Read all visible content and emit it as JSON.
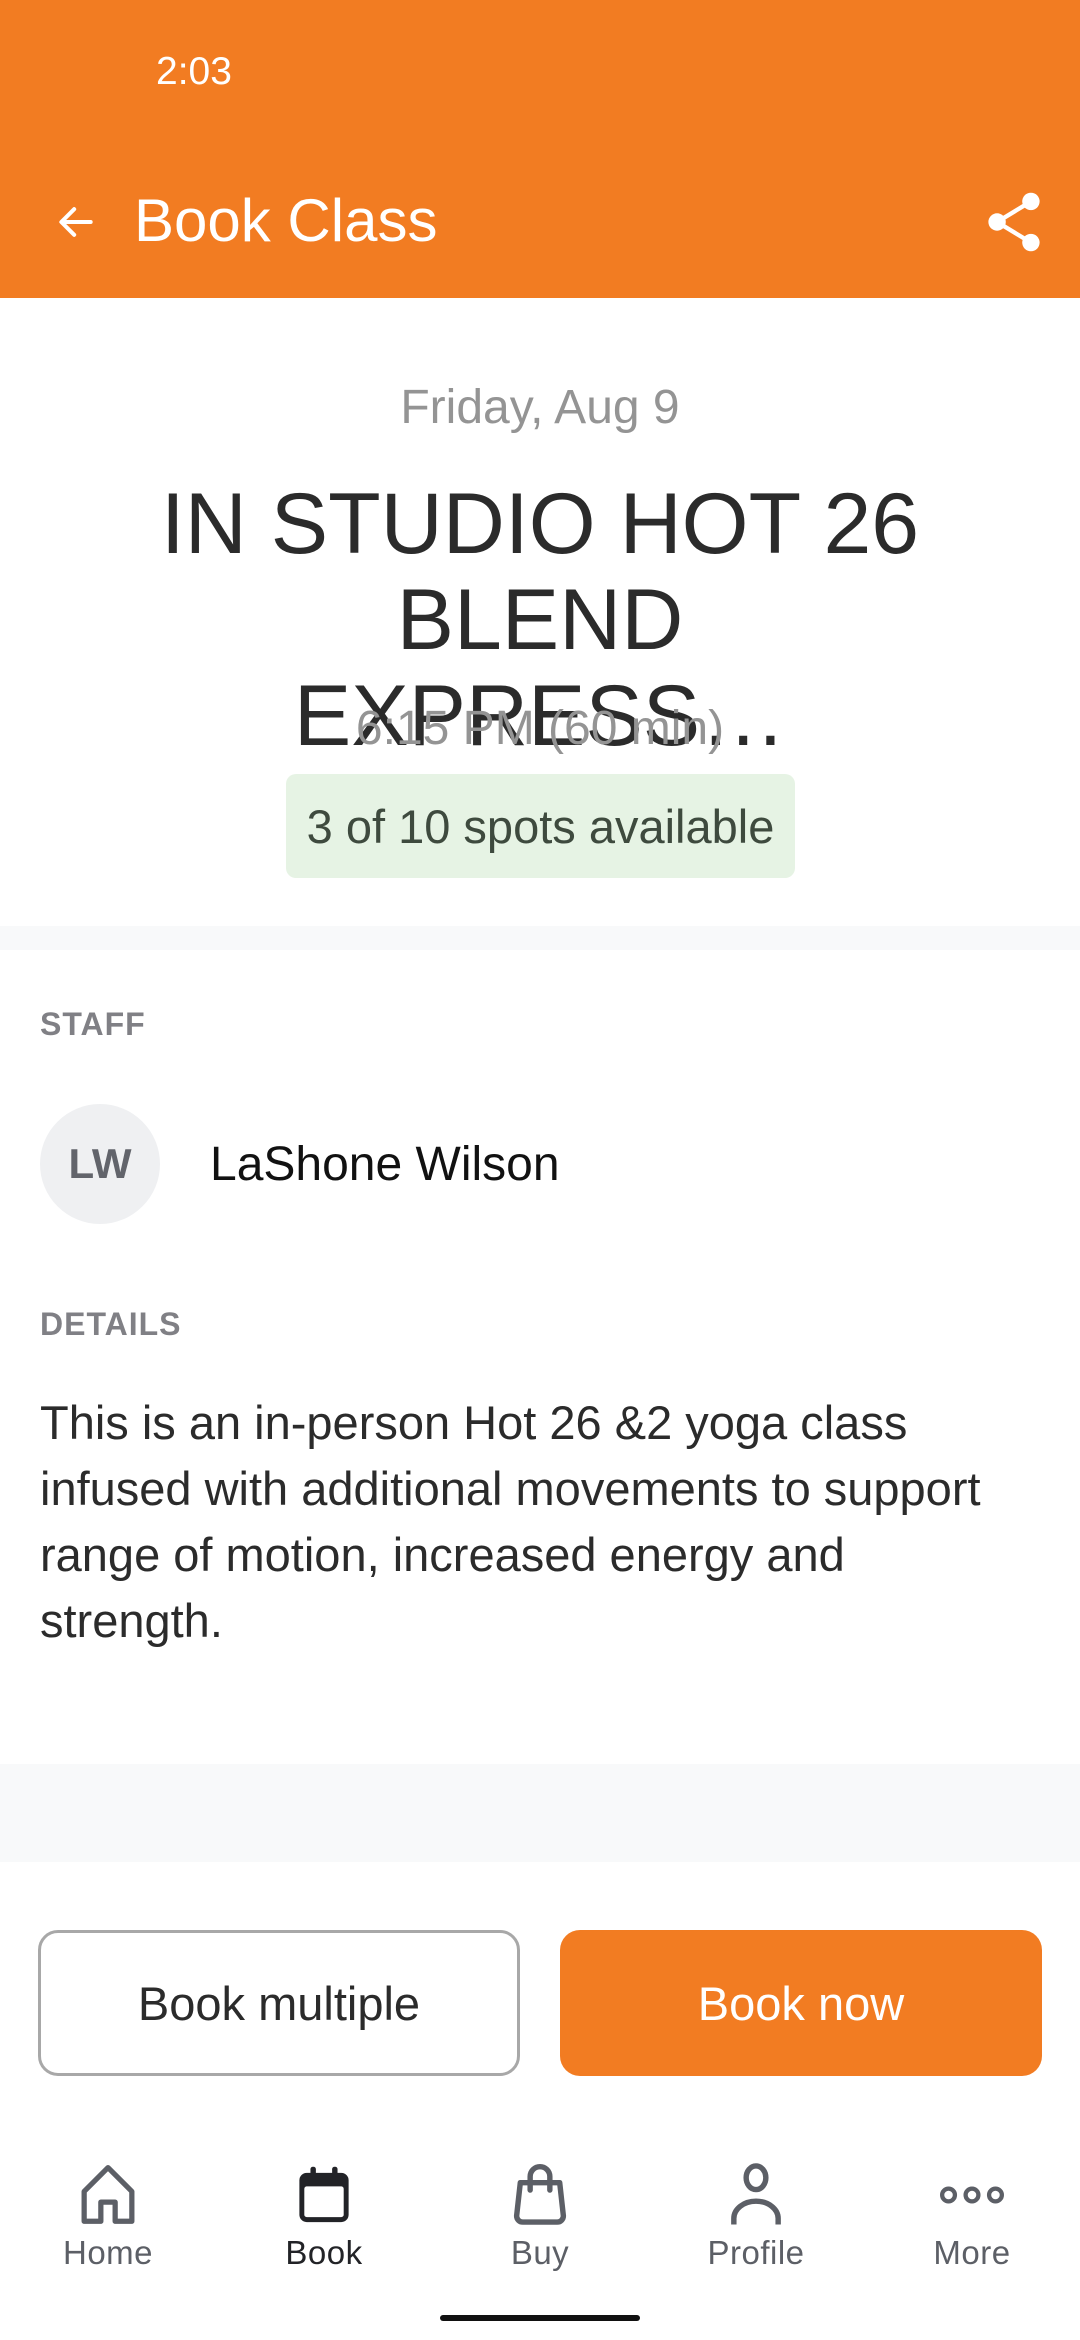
{
  "status_bar": {
    "time": "2:03"
  },
  "header": {
    "title": "Book Class",
    "back_icon": "arrow-left-icon",
    "share_icon": "share-icon",
    "background_color": "#f27c22"
  },
  "class": {
    "date": "Friday, Aug 9",
    "title": "IN STUDIO HOT 26 BLEND EXPRESS…",
    "time": "6:15 PM (60 min)",
    "spots_text": "3 of 10 spots available",
    "spots_available": 3,
    "spots_total": 10
  },
  "staff": {
    "label": "STAFF",
    "initials": "LW",
    "name": "LaShone Wilson"
  },
  "details": {
    "label": "DETAILS",
    "text": "This is an in-person Hot 26 &2 yoga class infused with additional movements to support range of motion, increased energy and strength."
  },
  "actions": {
    "book_multiple": "Book multiple",
    "book_now": "Book now"
  },
  "tabbar": {
    "active": "Book",
    "items": [
      {
        "label": "Home",
        "icon": "home-icon"
      },
      {
        "label": "Book",
        "icon": "calendar-icon"
      },
      {
        "label": "Buy",
        "icon": "shopping-bag-icon"
      },
      {
        "label": "Profile",
        "icon": "person-icon"
      },
      {
        "label": "More",
        "icon": "more-horizontal-icon"
      }
    ]
  },
  "colors": {
    "accent": "#f27c22",
    "badge_bg": "#e6f3e4",
    "section_label": "#808085"
  }
}
